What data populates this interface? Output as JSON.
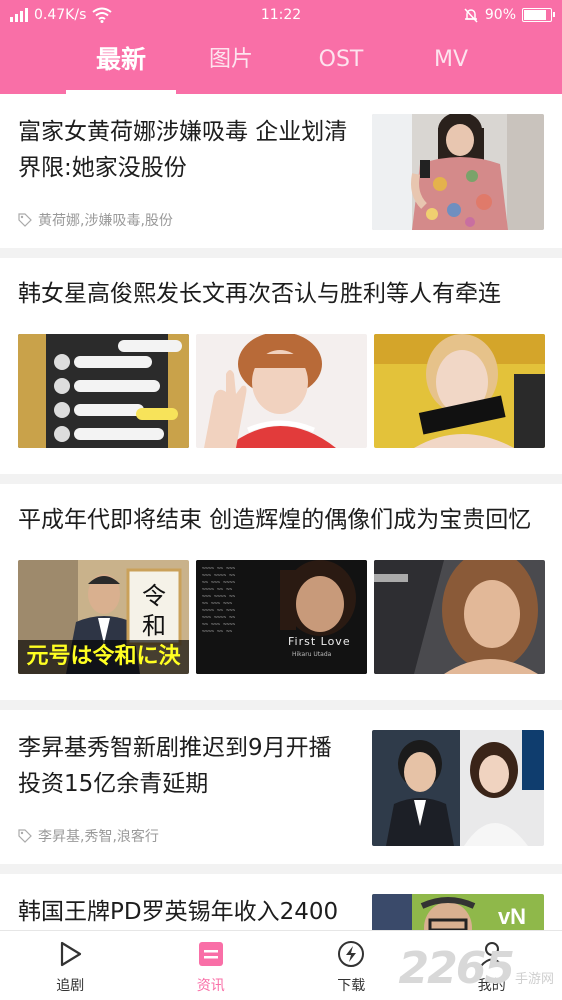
{
  "status": {
    "speed": "0.47K/s",
    "time": "11:22",
    "battery": "90%",
    "battery_level": 0.9
  },
  "tabs": [
    {
      "label": "最新",
      "active": true
    },
    {
      "label": "图片",
      "active": false
    },
    {
      "label": "OST",
      "active": false
    },
    {
      "label": "MV",
      "active": false
    }
  ],
  "feed": {
    "items": [
      {
        "title": "富家女黄荷娜涉嫌吸毒 企业划清界限:她家没股份",
        "tag": "黄荷娜,涉嫌吸毒,股份",
        "images": [
          "woman in floral dress holding phone"
        ]
      },
      {
        "title": "韩女星高俊熙发长文再次否认与胜利等人有牵连",
        "images": [
          "chat message screenshot",
          "woman waving hand",
          "woman with black choker"
        ]
      },
      {
        "title": "平成年代即将结束 创造辉煌的偶像们成为宝贵回忆",
        "images": [
          "man holding 令和 sign",
          "First Love album cover",
          "woman with long hair"
        ],
        "img_texts": {
          "sign_top": "令",
          "sign_bottom": "和",
          "caption": "元号は令和に決",
          "album_title": "First Love",
          "album_artist": "Hikaru Utada"
        }
      },
      {
        "title": "李昇基秀智新剧推迟到9月开播 投资15亿余青延期",
        "tag": "李昇基,秀智,浪客行",
        "images": [
          "couple at premiere event"
        ]
      },
      {
        "title": "韩国王牌PD罗英锡年收入2400",
        "images": [
          "man with glasses in front of tvN logo"
        ]
      }
    ]
  },
  "bottom_nav": [
    {
      "label": "追剧",
      "icon": "play-icon",
      "active": false
    },
    {
      "label": "资讯",
      "icon": "news-icon",
      "active": true
    },
    {
      "label": "下载",
      "icon": "download-icon",
      "active": false
    },
    {
      "label": "我的",
      "icon": "user-icon",
      "active": false
    }
  ],
  "watermark": {
    "number": "2265",
    "text": "手游网"
  },
  "colors": {
    "accent": "#f96fa7",
    "tab_inactive": "#fde3ee",
    "tag_gray": "#9a9a9a"
  }
}
